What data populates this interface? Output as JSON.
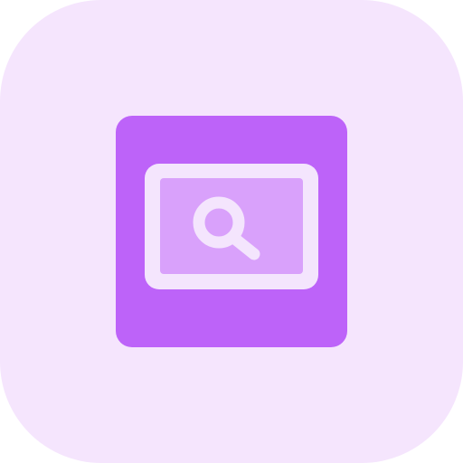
{
  "icon": {
    "name": "screen-search-icon",
    "colors": {
      "background": "#F5E5FD",
      "frame": "#BD63F9",
      "screen_border": "#F4E5FD",
      "screen_fill": "#D9A1FB",
      "magnifier": "#F4E5FD"
    }
  }
}
